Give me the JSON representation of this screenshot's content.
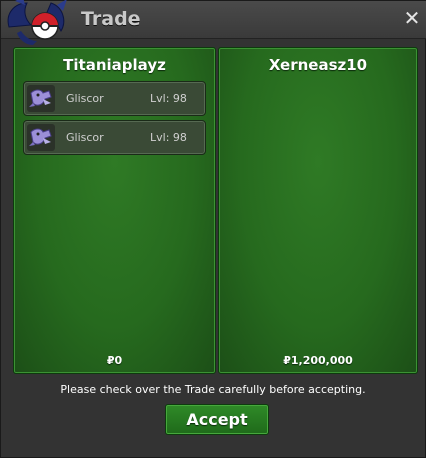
{
  "window": {
    "title": "Trade",
    "close_label": "✕"
  },
  "left_panel": {
    "player": "Titaniaplayz",
    "money": "₽0",
    "items": [
      {
        "name": "Gliscor",
        "level": "Lvl: 98"
      },
      {
        "name": "Gliscor",
        "level": "Lvl: 98"
      }
    ]
  },
  "right_panel": {
    "player": "Xerneasz10",
    "money": "₽1,200,000",
    "items": []
  },
  "notice": "Please check over the Trade carefully before accepting.",
  "accept_label": "Accept",
  "colors": {
    "panel_green": "#2f7a25",
    "accept_green": "#2f8a28",
    "titlebar": "#4a4a4a"
  },
  "icons": {
    "logo": "pokeball-creature-logo",
    "item_sprite": "gliscor-sprite-icon",
    "close": "close-icon"
  }
}
